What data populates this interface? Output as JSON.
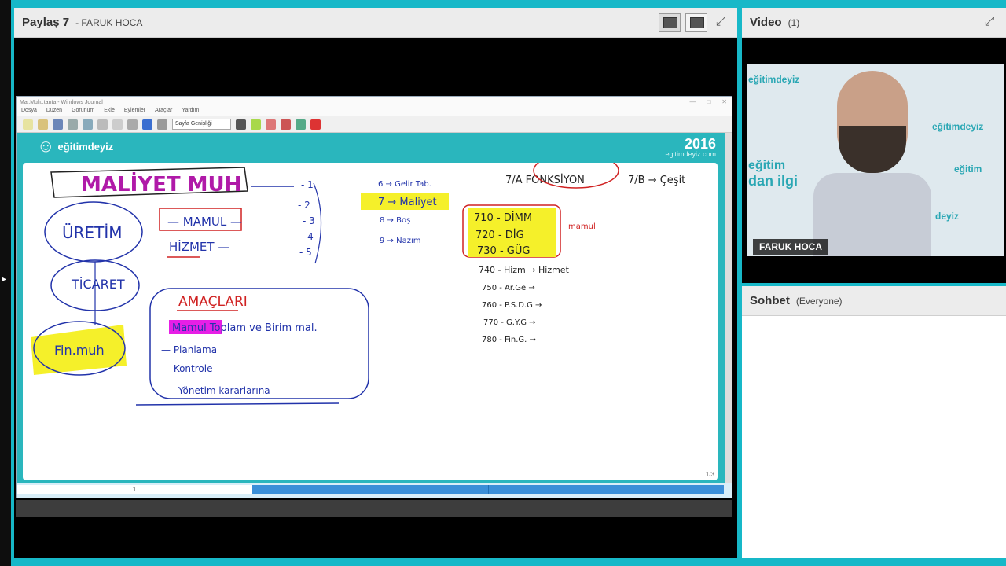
{
  "share": {
    "title": "Paylaş 7",
    "presenter": "- FARUK HOCA"
  },
  "journal": {
    "title": "Mal.Muh..tanta - Windows Journal",
    "menu": [
      "Dosya",
      "Düzen",
      "Görünüm",
      "Ekle",
      "Eylemler",
      "Araçlar",
      "Yardım"
    ],
    "page_width_label": "Sayfa Genişliği",
    "page_indicator": "1/3",
    "page_number": "1"
  },
  "slide": {
    "brand": "eğitimdeyiz",
    "year": "2016",
    "site": "egitimdeyiz.com",
    "colors": {
      "banner": "#2ab6bd",
      "highlight_yellow": "#f5f02a",
      "highlight_magenta": "#e61fe6"
    }
  },
  "handwriting": {
    "heading": "MALİYET MUH",
    "production": "ÜRETİM",
    "product": "— MAMUL —",
    "service": "HİZMET —",
    "trade": "TİCARET",
    "financial": "Fin.muh",
    "purposes_title": "AMAÇLARI",
    "purpose_items": [
      "Mamul  Toplam ve Birim mal.",
      "— Planlama",
      "— Kontrole",
      "— Yönetim kararlarına"
    ],
    "numbers": [
      "- 1",
      "- 2",
      "- 3",
      "- 4",
      "- 5"
    ],
    "class_list": [
      "6 → Gelir Tab.",
      "7 → Maliyet",
      "8 → Boş",
      "9 → Nazım"
    ],
    "fonksiyon": "7/A  FONKSİYON",
    "gesit": "7/B → Çeşit",
    "yellow_box": [
      "710 - DİMM",
      "720 - DİG",
      "730 - GÜG"
    ],
    "mamul_tag": "mamul",
    "hizmet_line": "740 - Hizm → Hizmet",
    "more_accounts": [
      "750 - Ar.Ge →",
      "760 - P.S.D.G →",
      "770 - G.Y.G →",
      "780 - Fin.G. →"
    ]
  },
  "video": {
    "title": "Video",
    "count": "(1)",
    "name_tag": "FARUK HOCA",
    "bg_labels": [
      "eğitimdeyiz",
      "eğitimdeyiz",
      "eğitim",
      "dan ilgi",
      "eğitim",
      "deyiz"
    ]
  },
  "chat": {
    "title": "Sohbet",
    "scope": "(Everyone)"
  }
}
